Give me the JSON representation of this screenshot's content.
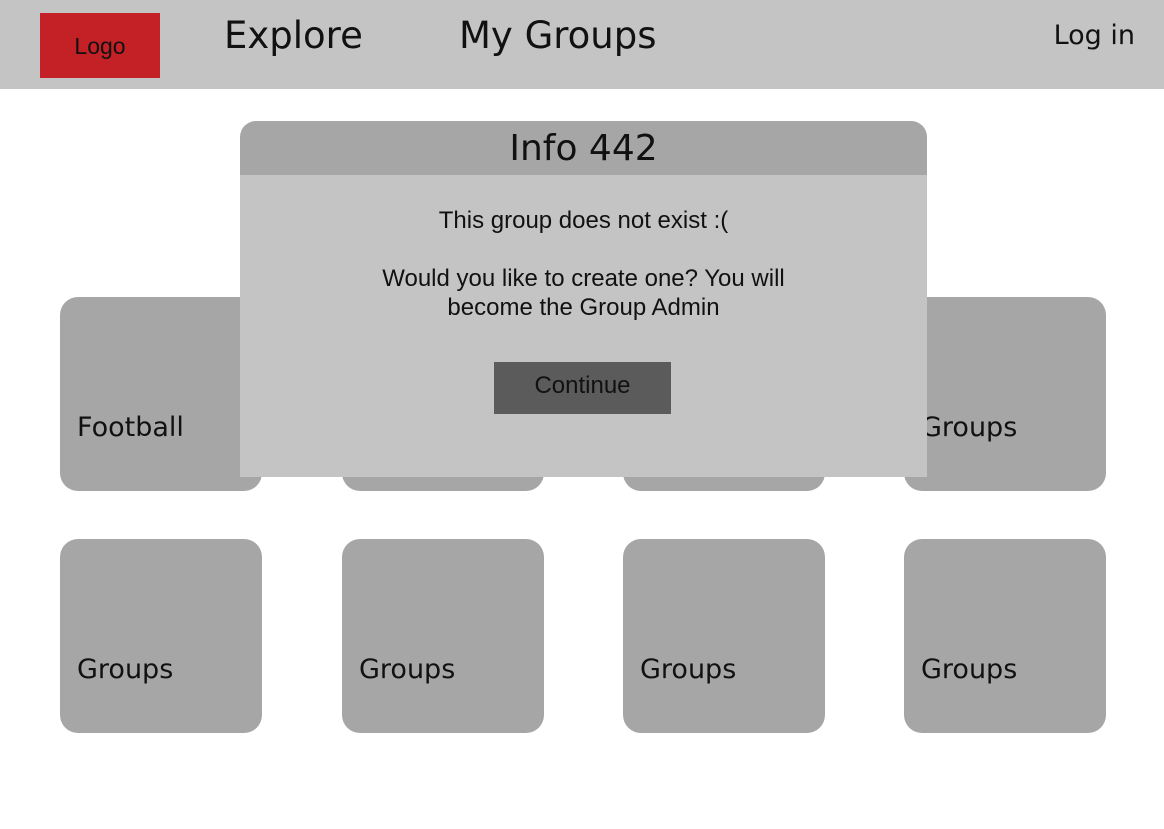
{
  "header": {
    "logo_label": "Logo",
    "nav": [
      "Explore",
      "My Groups"
    ],
    "login_label": "Log in"
  },
  "groups": {
    "row1": [
      "Football",
      "",
      "",
      "Groups"
    ],
    "row2": [
      "Groups",
      "Groups",
      "Groups",
      "Groups"
    ]
  },
  "modal": {
    "title": "Info 442",
    "message": "This group does not exist :(",
    "question": "Would you like to create one? You will become the Group Admin",
    "continue_label": "Continue"
  },
  "colors": {
    "header_bg": "#c4c4c4",
    "logo_bg": "#c32125",
    "tile_bg": "#a6a6a6",
    "modal_header_bg": "#a6a6a6",
    "modal_body_bg": "#c4c4c4",
    "button_bg": "#5b5b5b"
  }
}
